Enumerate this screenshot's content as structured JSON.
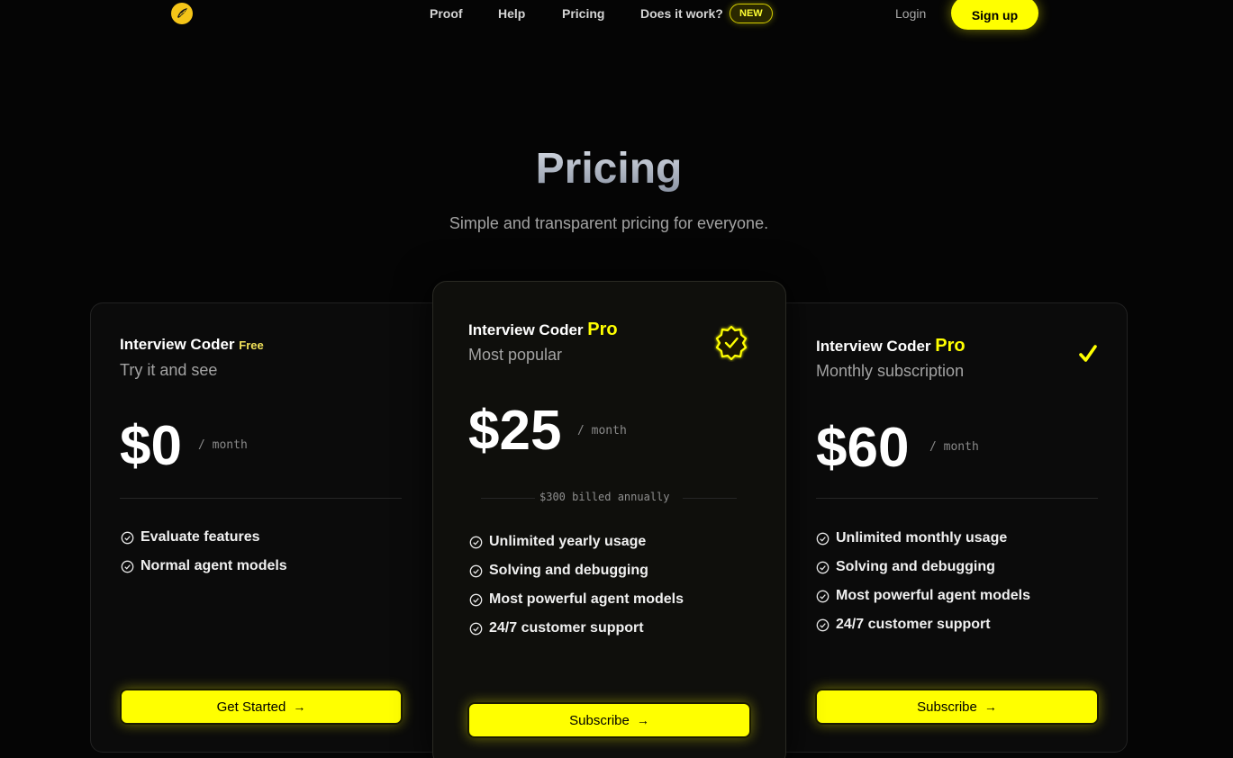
{
  "nav": {
    "links": [
      "Proof",
      "Help",
      "Pricing",
      "Does it work?"
    ],
    "badge": "NEW",
    "login": "Login",
    "signup": "Sign up"
  },
  "hero": {
    "title": "Pricing",
    "subtitle": "Simple and transparent pricing for everyone."
  },
  "plans": [
    {
      "name": "Interview Coder",
      "tier": "Free",
      "description": "Try it and see",
      "price": "$0",
      "period": "/ month",
      "features": [
        "Evaluate features",
        "Normal agent models"
      ],
      "cta": "Get Started"
    },
    {
      "name": "Interview Coder",
      "tier": "Pro",
      "description": "Most popular",
      "price": "$25",
      "period": "/ month",
      "billed": "$300 billed annually",
      "features": [
        "Unlimited yearly usage",
        "Solving and debugging",
        "Most powerful agent models",
        "24/7 customer support"
      ],
      "cta": "Subscribe"
    },
    {
      "name": "Interview Coder",
      "tier": "Pro",
      "description": "Monthly subscription",
      "price": "$60",
      "period": "/ month",
      "features": [
        "Unlimited monthly usage",
        "Solving and debugging",
        "Most powerful agent models",
        "24/7 customer support"
      ],
      "cta": "Subscribe"
    }
  ],
  "colors": {
    "accent": "#ffff00",
    "background": "#050505",
    "card": "#0b0b0b"
  },
  "icons": [
    "logo-icon",
    "check-circle-icon",
    "verified-badge-icon",
    "checkmark-icon",
    "arrow-right-icon"
  ]
}
